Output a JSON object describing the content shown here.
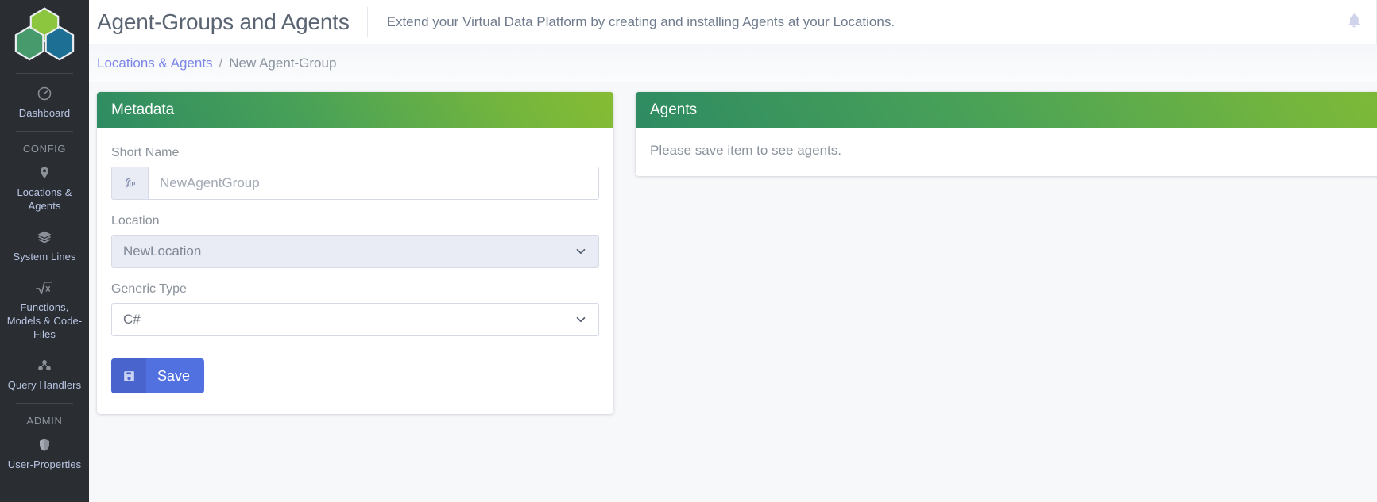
{
  "sidebar": {
    "logo": {
      "name": "hexagon-logo",
      "colors": [
        "#8cc63e",
        "#4a9b6e",
        "#1d6f93"
      ]
    },
    "dashboard": {
      "label": "Dashboard",
      "icon": "dashboard-icon"
    },
    "sections": [
      {
        "title": "CONFIG",
        "items": [
          {
            "label": "Locations & Agents",
            "icon": "location-pin-icon"
          },
          {
            "label": "System Lines",
            "icon": "layers-icon"
          },
          {
            "label": "Functions, Models & Code-Files",
            "icon": "sqrt-x-icon"
          },
          {
            "label": "Query Handlers",
            "icon": "nodes-icon"
          }
        ]
      },
      {
        "title": "ADMIN",
        "items": [
          {
            "label": "User-Properties",
            "icon": "shield-icon"
          }
        ]
      }
    ]
  },
  "header": {
    "title": "Agent-Groups and Agents",
    "subtitle": "Extend your Virtual Data Platform by creating and installing Agents at your Locations.",
    "notifications_icon": "bell-icon"
  },
  "breadcrumb": {
    "parent": "Locations & Agents",
    "separator": "/",
    "current": "New Agent-Group"
  },
  "metadata_card": {
    "title": "Metadata",
    "fields": {
      "short_name": {
        "label": "Short Name",
        "value": "",
        "placeholder": "NewAgentGroup",
        "prefix_icon": "fingerprint-icon"
      },
      "location": {
        "label": "Location",
        "selected": "NewLocation",
        "disabled": true,
        "chevron_icon": "chevron-down-icon"
      },
      "generic_type": {
        "label": "Generic Type",
        "selected": "C#",
        "disabled": false,
        "chevron_icon": "chevron-down-icon"
      }
    },
    "save_button": {
      "label": "Save",
      "icon": "floppy-disk-icon"
    }
  },
  "agents_card": {
    "title": "Agents",
    "empty_message": "Please save item to see agents."
  },
  "colors": {
    "card_header_green_dark": "#2e8b62",
    "card_header_green_light": "#86bc33",
    "sidebar_bg": "#2a2e33",
    "link_blue": "#7b86e8",
    "save_blue": "#5271e0",
    "save_blue_dark": "#4964cd"
  }
}
